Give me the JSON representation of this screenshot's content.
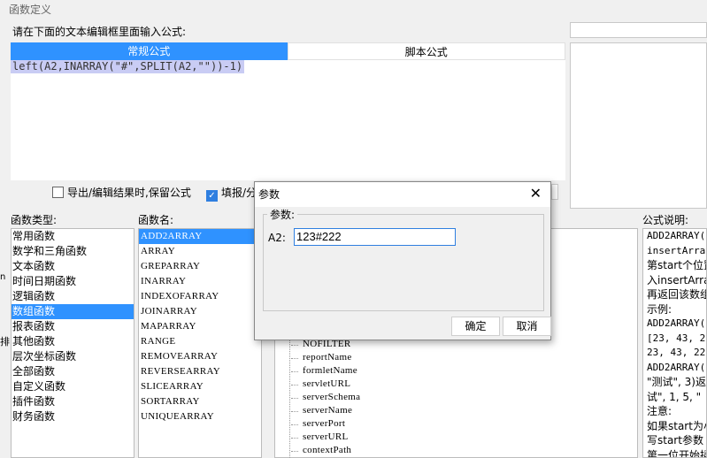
{
  "window": {
    "title": "函数定义"
  },
  "prompt": "请在下面的文本编辑框里面输入公式:",
  "tabs": [
    {
      "label": "常规公式"
    },
    {
      "label": "脚本公式"
    }
  ],
  "formula": "left(A2,INARRAY(\"#\",SPLIT(A2,\"\"))-1)",
  "options": {
    "export_keep_formula": "导出/编辑结果时,保留公式",
    "fill_report": "填报/分"
  },
  "labels": {
    "category": "函数类型:",
    "function_name": "函数名:",
    "description": "公式说明:"
  },
  "categories": [
    "常用函数",
    "数学和三角函数",
    "文本函数",
    "时间日期函数",
    "逻辑函数",
    "数组函数",
    "报表函数",
    "其他函数",
    "层次坐标函数",
    "全部函数",
    "自定义函数",
    "插件函数",
    "财务函数"
  ],
  "selected_category_index": 5,
  "functions": [
    "ADD2ARRAY",
    "ARRAY",
    "GREPARRAY",
    "INARRAY",
    "INDEXOFARRAY",
    "JOINARRAY",
    "MAPARRAY",
    "RANGE",
    "REMOVEARRAY",
    "REVERSEARRAY",
    "SLICEARRAY",
    "SORTARRAY",
    "UNIQUEARRAY"
  ],
  "selected_function_index": 0,
  "parameters": [
    "NOFILTER",
    "reportName",
    "formletName",
    "servletURL",
    "serverSchema",
    "serverName",
    "serverPort",
    "serverURL",
    "contextPath"
  ],
  "description_lines": [
    "ADD2ARRAY(a",
    "insertArray,",
    "第start个位置",
    "入insertArra",
    "再返回该数组",
    "示例:",
    "ADD2ARRAY([",
    "[23, 43, 22]",
    "23, 43, 22,",
    "ADD2ARRAY([",
    "\"测试\", 3)返",
    "试\", 1, 5, \"",
    "注意:",
    "如果start为小",
    "写start参数",
    "第一位开始插"
  ],
  "left_edge_glyphs": [
    "n",
    "排"
  ],
  "dialog": {
    "title": "参数",
    "close_glyph": "✕",
    "group_title": "参数:",
    "param_label": "A2:",
    "param_value": "123#222",
    "ok": "确定",
    "cancel": "取消"
  },
  "colors": {
    "accent": "#2f92ff",
    "selection_bg": "#c9ccf4"
  }
}
